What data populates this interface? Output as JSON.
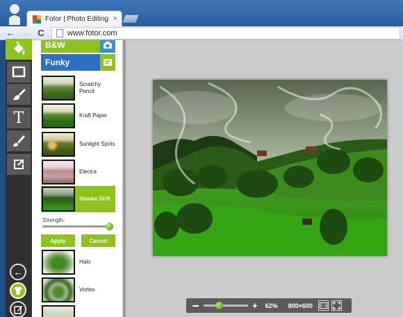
{
  "browser": {
    "tab_title": "Fotor | Photo Editing Made Simple",
    "tab_close": "×",
    "url": "www.fotor.com",
    "back_glyph": "←",
    "forward_glyph": "→",
    "reload_glyph": "C"
  },
  "tools": [
    {
      "icon": "paint-bucket-icon",
      "active": true
    },
    {
      "icon": "crop-frame-icon",
      "active": false
    },
    {
      "icon": "brush-stroke-icon",
      "active": false
    },
    {
      "icon": "text-icon",
      "label": "T",
      "active": false
    },
    {
      "icon": "paintbrush-icon",
      "active": false
    },
    {
      "icon": "export-icon",
      "active": false
    }
  ],
  "bottom_tools": [
    {
      "icon": "back-arrow-icon",
      "glyph": "←"
    },
    {
      "icon": "tshirt-icon"
    },
    {
      "icon": "edit-icon"
    }
  ],
  "categories": {
    "bw": "B&W",
    "funky": "Funky"
  },
  "effects": [
    {
      "label": "Scratchy Pencil",
      "selected": false
    },
    {
      "label": "Kraft Paper",
      "selected": false
    },
    {
      "label": "Sunlight Spots",
      "selected": false
    },
    {
      "label": "Electra",
      "selected": false
    },
    {
      "label": "Smoke Drift",
      "selected": true
    },
    {
      "label": "Halo",
      "selected": false
    },
    {
      "label": "Vortex",
      "selected": false
    }
  ],
  "strength": {
    "label": "Strength:",
    "value": 0.98
  },
  "buttons": {
    "apply": "Apply",
    "cancel": "Cancel"
  },
  "zoom": {
    "percent": "62%",
    "dimensions": "800×600",
    "level": 0.35
  },
  "colors": {
    "accent_green": "#8dc21f",
    "funky_blue": "#2f6fc1",
    "toolstrip": "#303030"
  }
}
